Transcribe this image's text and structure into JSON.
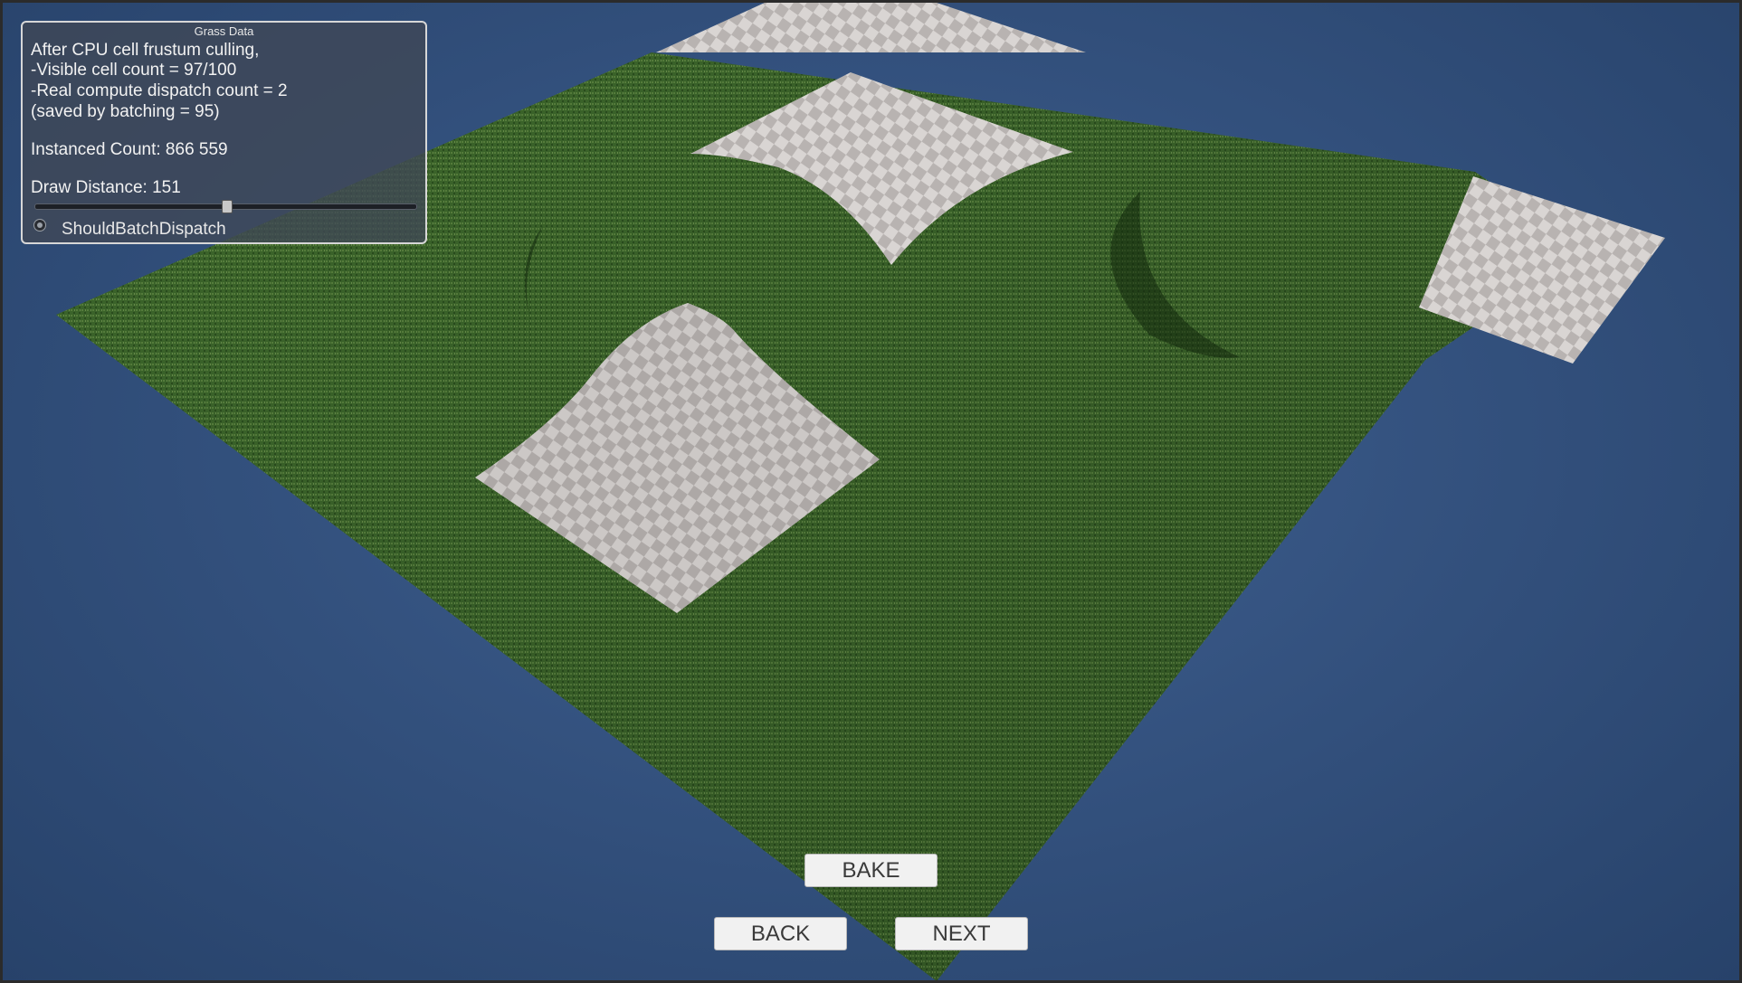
{
  "hud": {
    "title": "Grass Data",
    "culling_heading": "After CPU cell frustum culling,",
    "visible_cells": "-Visible cell count = 97/100",
    "dispatch_count": "-Real compute dispatch count = 2",
    "saved_by_batching": "(saved by batching = 95)",
    "instanced_count": "Instanced Count: 866 559",
    "draw_distance": "Draw Distance: 151",
    "draw_distance_fraction": 0.5,
    "toggle_label": "ShouldBatchDispatch"
  },
  "buttons": {
    "bake": "BAKE",
    "back": "BACK",
    "next": "NEXT"
  },
  "colors": {
    "background": "#34527f",
    "grass": "#3d6a2c",
    "checker_light": "#d8d4d2",
    "checker_dark": "#b8b3b1"
  }
}
